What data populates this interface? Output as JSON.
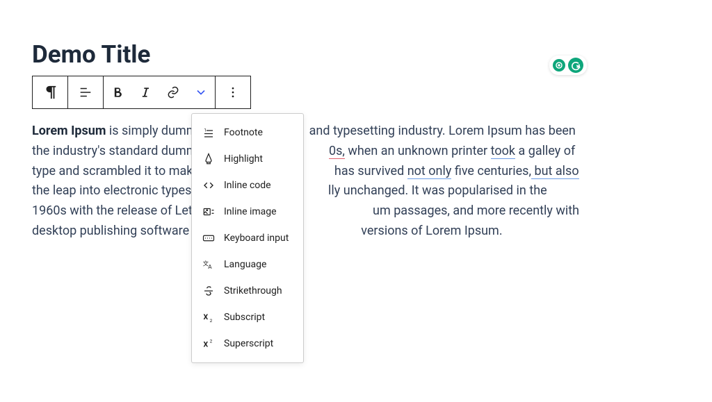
{
  "title": "Demo Title",
  "content": {
    "strong": "Lorem Ipsum",
    "t1": " is simply dumm",
    "t2": "and typesetting industry. Lorem Ipsum has been the industry's standard dummy te",
    "t3": "0s,",
    "t4": " when an unknown printer ",
    "t5": "took",
    "t6": " a galley of type and scrambled it to make a ty",
    "t7": "has survived ",
    "t8": "not only",
    "t9": " five centuries,",
    "t10": " but also",
    "t11": " the leap into electronic typesettin",
    "t12": "lly unchanged. It was popularised in the 1960s with the release of Letraset sheets",
    "t13": "um passages, and more recently with desktop publishing software like Aldus",
    "t14": " versions of Lorem Ipsum."
  },
  "dropdown": {
    "items": [
      {
        "label": "Footnote",
        "icon": "footnote-icon"
      },
      {
        "label": "Highlight",
        "icon": "highlight-icon"
      },
      {
        "label": "Inline code",
        "icon": "inline-code-icon"
      },
      {
        "label": "Inline image",
        "icon": "inline-image-icon"
      },
      {
        "label": "Keyboard input",
        "icon": "keyboard-input-icon"
      },
      {
        "label": "Language",
        "icon": "language-icon"
      },
      {
        "label": "Strikethrough",
        "icon": "strikethrough-icon"
      },
      {
        "label": "Subscript",
        "icon": "subscript-icon"
      },
      {
        "label": "Superscript",
        "icon": "superscript-icon"
      }
    ]
  }
}
